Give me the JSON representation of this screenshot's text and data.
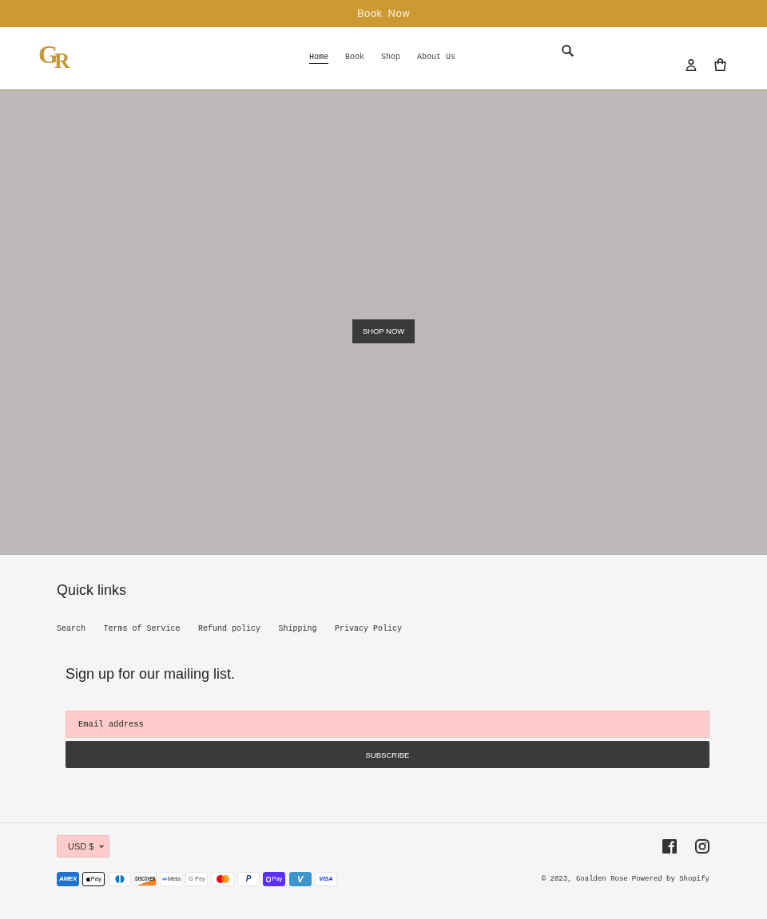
{
  "announcement": {
    "text": "Book Now"
  },
  "header": {
    "logo": {
      "letters": [
        "G",
        "R"
      ]
    },
    "nav": [
      {
        "label": "Home",
        "selected": true
      },
      {
        "label": "Book",
        "selected": false
      },
      {
        "label": "Shop",
        "selected": false
      },
      {
        "label": "About Us",
        "selected": false
      }
    ]
  },
  "hero": {
    "button": "SHOP NOW"
  },
  "footer": {
    "quick_links": {
      "title": "Quick links",
      "links": [
        "Search",
        "Terms of Service",
        "Refund policy",
        "Shipping",
        "Privacy Policy"
      ]
    },
    "newsletter": {
      "title": "Sign up for our mailing list.",
      "email": {
        "placeholder": "Email address"
      },
      "button": "SUBSCRIBE"
    },
    "currency": {
      "value": "USD $"
    },
    "payment_methods": [
      {
        "kind": "amex",
        "label": "AMEX"
      },
      {
        "kind": "apple_pay",
        "label": "Pay"
      },
      {
        "kind": "diners"
      },
      {
        "kind": "discover",
        "label": "DISCOVER"
      },
      {
        "kind": "meta_pay",
        "label": "Meta"
      },
      {
        "kind": "google_pay",
        "label": "G Pay"
      },
      {
        "kind": "mastercard"
      },
      {
        "kind": "paypal",
        "label": "P"
      },
      {
        "kind": "shop_pay",
        "label": "Pay"
      },
      {
        "kind": "venmo",
        "label": "V"
      },
      {
        "kind": "visa",
        "label": "VISA"
      }
    ],
    "copyright": "© 2023, Goalden Rose",
    "powered_by": "Powered by Shopify"
  }
}
